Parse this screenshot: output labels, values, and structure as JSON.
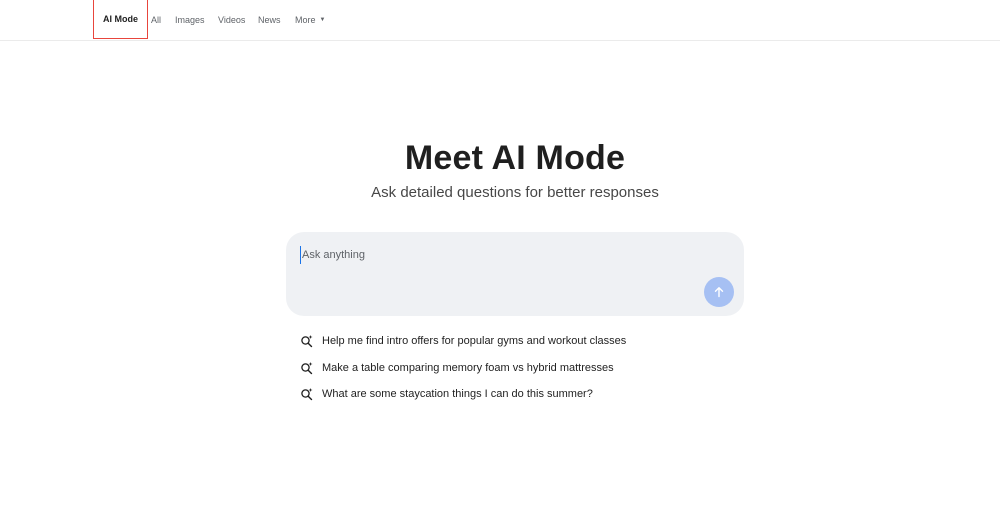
{
  "nav": {
    "tabs": [
      {
        "label": "AI Mode",
        "active": true
      },
      {
        "label": "All"
      },
      {
        "label": "Images"
      },
      {
        "label": "Videos"
      },
      {
        "label": "News"
      },
      {
        "label": "More"
      }
    ]
  },
  "hero": {
    "title": "Meet AI Mode",
    "subtitle": "Ask detailed questions for better responses"
  },
  "search": {
    "placeholder": "Ask anything",
    "value": ""
  },
  "suggestions": [
    {
      "text": "Help me find intro offers for popular gyms and workout classes",
      "icon": "search-sparkle-icon"
    },
    {
      "text": "Make a table comparing memory foam vs hybrid mattresses",
      "icon": "search-sparkle-icon"
    },
    {
      "text": "What are some staycation things I can do this summer?",
      "icon": "search-sparkle-icon"
    }
  ],
  "colors": {
    "active_outline": "#e8453c",
    "send_button": "#a6c0f3",
    "ask_box_bg": "#eff1f4"
  }
}
